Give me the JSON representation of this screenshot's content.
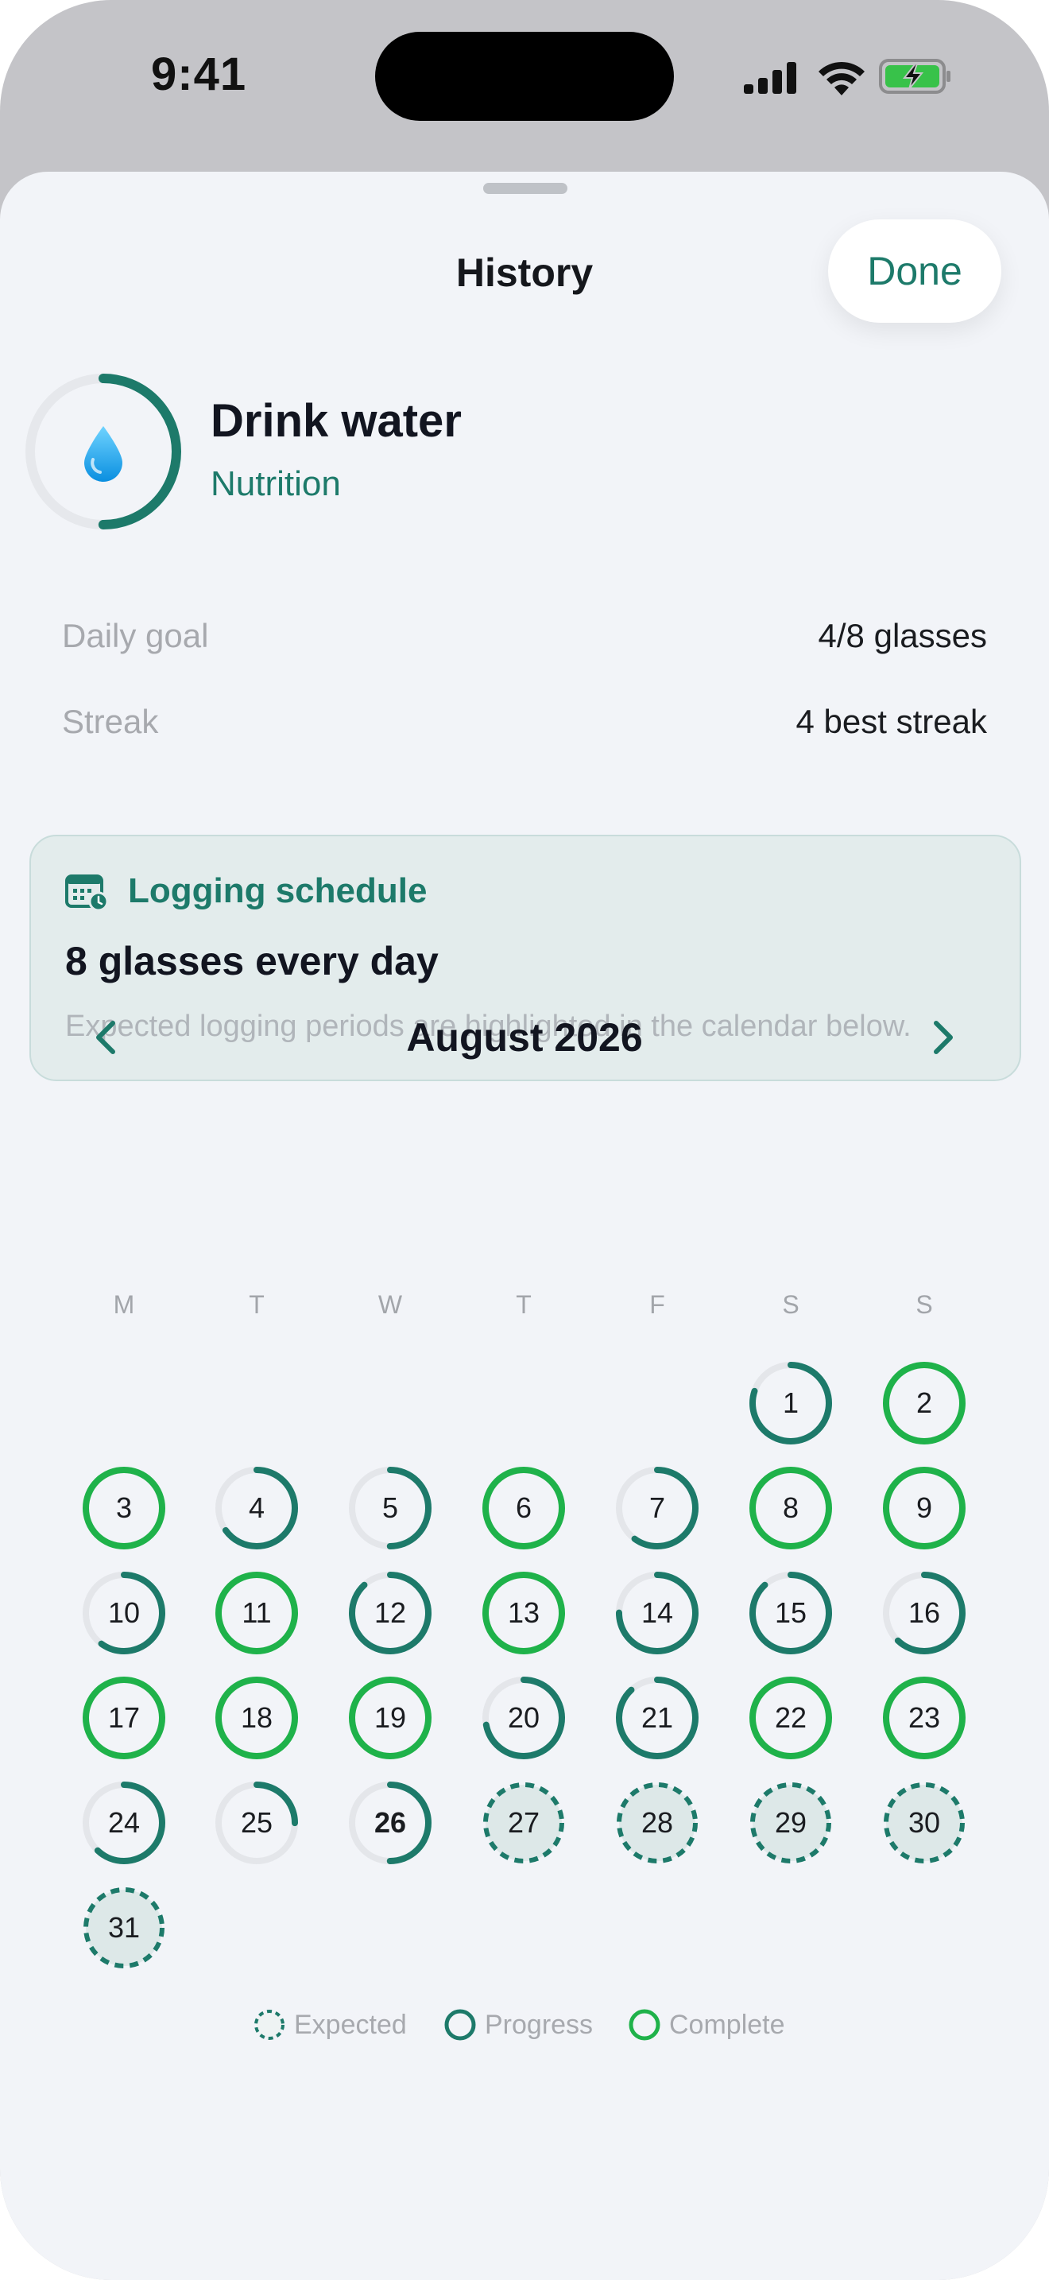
{
  "status_bar": {
    "time": "9:41",
    "icons": [
      "signal-icon",
      "wifi-icon",
      "battery-charging-icon"
    ]
  },
  "sheet": {
    "title": "History",
    "done_label": "Done"
  },
  "habit": {
    "name": "Drink water",
    "category": "Nutrition",
    "icon": "water-drop-icon",
    "progress": 0.5
  },
  "stats": {
    "daily_goal_label": "Daily goal",
    "daily_goal_value": "4/8 glasses",
    "streak_label": "Streak",
    "streak_value": "4 best streak"
  },
  "schedule": {
    "icon": "calendar-clock-icon",
    "title": "Logging schedule",
    "summary": "8 glasses every day",
    "note": "Expected logging periods are highlighted in the calendar below."
  },
  "calendar": {
    "month_label": "August 2026",
    "weekdays": [
      "M",
      "T",
      "W",
      "T",
      "F",
      "S",
      "S"
    ],
    "first_weekday_index": 5,
    "today": 26,
    "days": [
      {
        "day": 1,
        "state": "progress",
        "progress": 0.8
      },
      {
        "day": 2,
        "state": "complete",
        "progress": 1
      },
      {
        "day": 3,
        "state": "complete",
        "progress": 1
      },
      {
        "day": 4,
        "state": "progress",
        "progress": 0.65
      },
      {
        "day": 5,
        "state": "progress",
        "progress": 0.5
      },
      {
        "day": 6,
        "state": "complete",
        "progress": 1
      },
      {
        "day": 7,
        "state": "progress",
        "progress": 0.6
      },
      {
        "day": 8,
        "state": "complete",
        "progress": 1
      },
      {
        "day": 9,
        "state": "complete",
        "progress": 1
      },
      {
        "day": 10,
        "state": "progress",
        "progress": 0.6
      },
      {
        "day": 11,
        "state": "complete",
        "progress": 1
      },
      {
        "day": 12,
        "state": "progress",
        "progress": 0.88
      },
      {
        "day": 13,
        "state": "complete",
        "progress": 1
      },
      {
        "day": 14,
        "state": "progress",
        "progress": 0.75
      },
      {
        "day": 15,
        "state": "progress",
        "progress": 0.88
      },
      {
        "day": 16,
        "state": "progress",
        "progress": 0.62
      },
      {
        "day": 17,
        "state": "complete",
        "progress": 1
      },
      {
        "day": 18,
        "state": "complete",
        "progress": 1
      },
      {
        "day": 19,
        "state": "complete",
        "progress": 1
      },
      {
        "day": 20,
        "state": "progress",
        "progress": 0.72
      },
      {
        "day": 21,
        "state": "progress",
        "progress": 0.88
      },
      {
        "day": 22,
        "state": "complete",
        "progress": 1
      },
      {
        "day": 23,
        "state": "complete",
        "progress": 1
      },
      {
        "day": 24,
        "state": "progress",
        "progress": 0.62
      },
      {
        "day": 25,
        "state": "progress",
        "progress": 0.25
      },
      {
        "day": 26,
        "state": "progress",
        "progress": 0.5
      },
      {
        "day": 27,
        "state": "expected"
      },
      {
        "day": 28,
        "state": "expected"
      },
      {
        "day": 29,
        "state": "expected"
      },
      {
        "day": 30,
        "state": "expected"
      },
      {
        "day": 31,
        "state": "expected"
      }
    ]
  },
  "legend": {
    "expected": "Expected",
    "progress": "Progress",
    "complete": "Complete"
  },
  "colors": {
    "accent": "#1d7a6a",
    "complete": "#1fb24a",
    "track": "#e4e6ea",
    "expected_fill": "#dde8e8",
    "background": "#f2f4f8"
  }
}
